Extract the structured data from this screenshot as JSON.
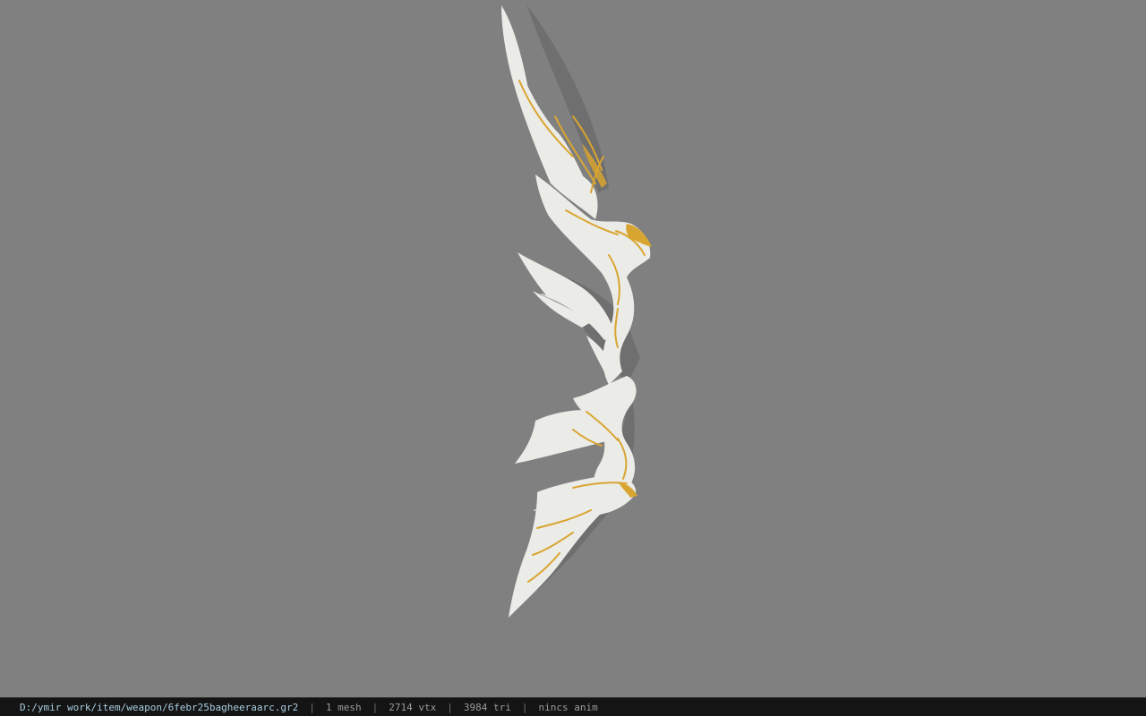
{
  "viewport": {
    "background": "#808080",
    "model_name": "bow-model"
  },
  "status": {
    "file_path": "D:/ymir work/item/weapon/6febr25bagheeraarc.gr2",
    "separator": "|",
    "mesh": "1 mesh",
    "vertices": "2714 vtx",
    "triangles": "3984 tri",
    "animation": "nincs anim"
  },
  "colors": {
    "bow_body": "#ebebe8",
    "bow_shadow": "#6a6a6a",
    "gold_trim": "#d9a531",
    "statusbar_bg": "#141414",
    "path_text": "#a8cde0"
  }
}
